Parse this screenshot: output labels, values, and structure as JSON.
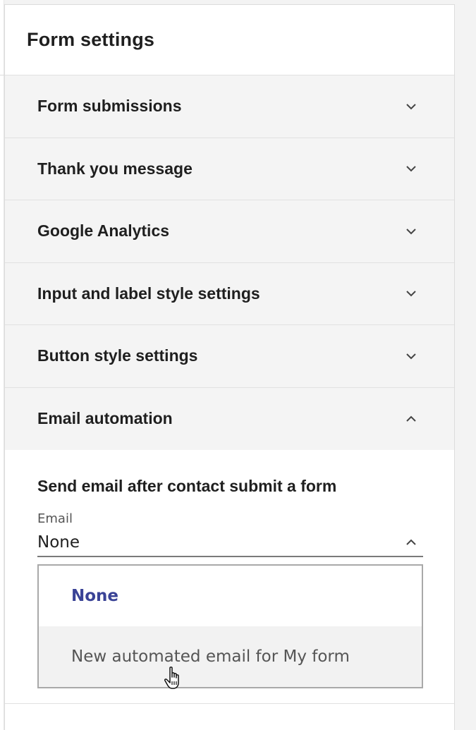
{
  "panel": {
    "title": "Form settings"
  },
  "sections": [
    {
      "label": "Form submissions",
      "icon": "chevron-down-icon",
      "expanded": false
    },
    {
      "label": "Thank you message",
      "icon": "chevron-down-icon",
      "expanded": false
    },
    {
      "label": "Google Analytics",
      "icon": "chevron-down-icon",
      "expanded": false
    },
    {
      "label": "Input and label style settings",
      "icon": "chevron-down-icon",
      "expanded": false
    },
    {
      "label": "Button style settings",
      "icon": "chevron-down-icon",
      "expanded": false
    },
    {
      "label": "Email automation",
      "icon": "chevron-up-icon",
      "expanded": true
    }
  ],
  "email_automation": {
    "heading": "Send email after contact submit a form",
    "email_field": {
      "label": "Email",
      "value": "None",
      "icon": "chevron-up-icon"
    },
    "options": [
      {
        "label": "None",
        "selected": true
      },
      {
        "label": "New automated email for My form",
        "hovered": true
      }
    ]
  },
  "colors": {
    "selected_option": "#3a4396",
    "section_background": "#f4f4f4"
  }
}
